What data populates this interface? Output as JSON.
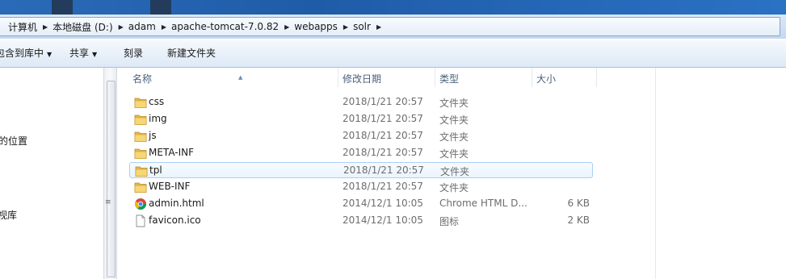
{
  "address": {
    "crumbs": [
      "计算机",
      "本地磁盘 (D:)",
      "adam",
      "apache-tomcat-7.0.82",
      "webapps",
      "solr"
    ]
  },
  "toolbar": {
    "include_library": "包含到库中",
    "share": "共享",
    "burn": "刻录",
    "new_folder": "新建文件夹"
  },
  "nav": {
    "items": [
      "的位置",
      "视库"
    ]
  },
  "columns": {
    "name": "名称",
    "modified": "修改日期",
    "type": "类型",
    "size": "大小"
  },
  "files": [
    {
      "name": "css",
      "date": "2018/1/21 20:57",
      "type": "文件夹",
      "size": "",
      "icon": "folder-icon"
    },
    {
      "name": "img",
      "date": "2018/1/21 20:57",
      "type": "文件夹",
      "size": "",
      "icon": "folder-icon"
    },
    {
      "name": "js",
      "date": "2018/1/21 20:57",
      "type": "文件夹",
      "size": "",
      "icon": "folder-icon"
    },
    {
      "name": "META-INF",
      "date": "2018/1/21 20:57",
      "type": "文件夹",
      "size": "",
      "icon": "folder-icon"
    },
    {
      "name": "tpl",
      "date": "2018/1/21 20:57",
      "type": "文件夹",
      "size": "",
      "icon": "folder-icon",
      "selected": true
    },
    {
      "name": "WEB-INF",
      "date": "2018/1/21 20:57",
      "type": "文件夹",
      "size": "",
      "icon": "folder-icon"
    },
    {
      "name": "admin.html",
      "date": "2014/12/1 10:05",
      "type": "Chrome HTML D...",
      "size": "6 KB",
      "icon": "chrome-html-icon"
    },
    {
      "name": "favicon.ico",
      "date": "2014/12/1 10:05",
      "type": "图标",
      "size": "2 KB",
      "icon": "file-icon"
    }
  ]
}
